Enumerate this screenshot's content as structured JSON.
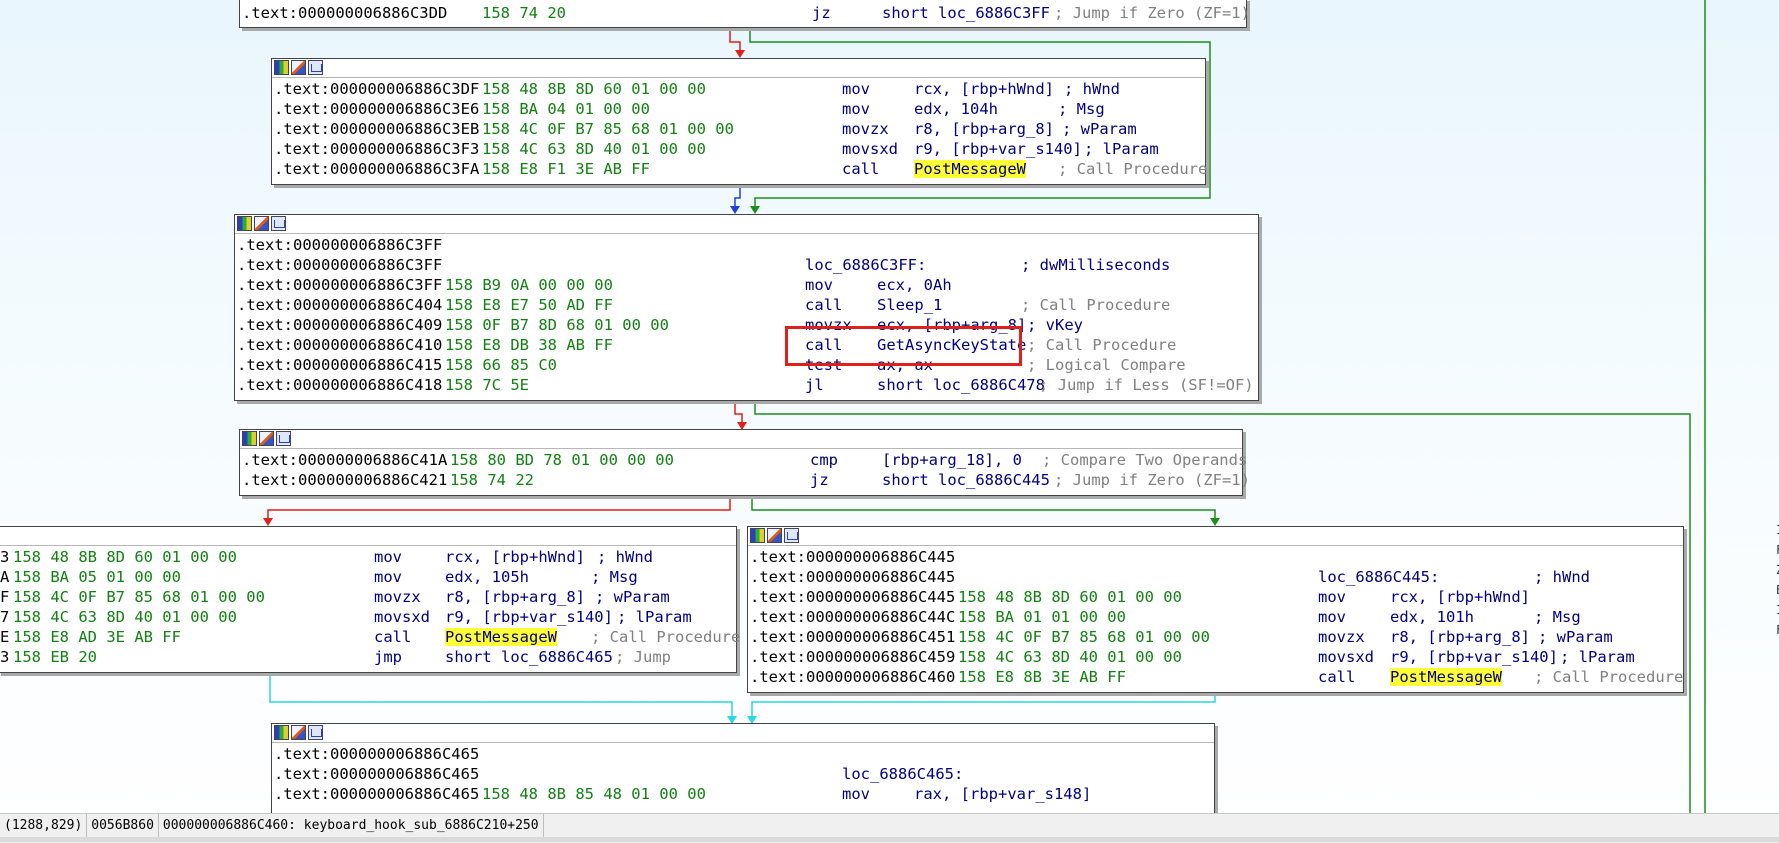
{
  "colors": {
    "edge_false": "#e0201a",
    "edge_true": "#1a8f1a",
    "edge_uncond": "#1f3fe0",
    "edge_merge": "#27d6e8",
    "highlight": "#ffff33",
    "address": "#000000",
    "bytes": "#138013",
    "mnemonic": "#000080",
    "comment": "#808080",
    "selection_box": "#e0201a"
  },
  "blocks": {
    "b1": {
      "lines": [
        {
          "addr": ".text:000000006886C3DD",
          "bytes": "158 74 20",
          "mn": "jz",
          "op": "short loc_6886C3FF",
          "cm": "; Jump if Zero (ZF=1)"
        }
      ]
    },
    "b2": {
      "lines": [
        {
          "addr": ".text:000000006886C3DF",
          "bytes": "158 48 8B 8D 60 01 00 00",
          "mn": "mov",
          "op": "rcx, [rbp+hWnd]",
          "cm": "; hWnd"
        },
        {
          "addr": ".text:000000006886C3E6",
          "bytes": "158 BA 04 01 00 00",
          "mn": "mov",
          "op": "edx, 104h",
          "cm": "; Msg"
        },
        {
          "addr": ".text:000000006886C3EB",
          "bytes": "158 4C 0F B7 85 68 01 00 00",
          "mn": "movzx",
          "op": "r8, [rbp+arg_8]",
          "cm": "; wParam"
        },
        {
          "addr": ".text:000000006886C3F3",
          "bytes": "158 4C 63 8D 40 01 00 00",
          "mn": "movsxd",
          "op": "r9, [rbp+var_s140]",
          "cm": "; lParam"
        },
        {
          "addr": ".text:000000006886C3FA",
          "bytes": "158 E8 F1 3E AB FF",
          "mn": "call",
          "op": "PostMessageW",
          "cm": "; Call Procedure"
        }
      ]
    },
    "b3": {
      "label": "loc_6886C3FF:",
      "label_cm": "; dwMilliseconds",
      "lines": [
        {
          "addr": ".text:000000006886C3FF",
          "bytes": "",
          "mn": "",
          "op": "",
          "cm": ""
        },
        {
          "addr": ".text:000000006886C3FF",
          "bytes": "",
          "mn": "",
          "op": "",
          "cm": ""
        },
        {
          "addr": ".text:000000006886C3FF",
          "bytes": "158 B9 0A 00 00 00",
          "mn": "mov",
          "op": "ecx, 0Ah",
          "cm": ""
        },
        {
          "addr": ".text:000000006886C404",
          "bytes": "158 E8 E7 50 AD FF",
          "mn": "call",
          "op": "Sleep_1",
          "cm": "; Call Procedure"
        },
        {
          "addr": ".text:000000006886C409",
          "bytes": "158 0F B7 8D 68 01 00 00",
          "mn": "movzx",
          "op": "ecx, [rbp+arg_8]",
          "cm": "; vKey"
        },
        {
          "addr": ".text:000000006886C410",
          "bytes": "158 E8 DB 38 AB FF",
          "mn": "call",
          "op": "GetAsyncKeyState",
          "cm": "; Call Procedure"
        },
        {
          "addr": ".text:000000006886C415",
          "bytes": "158 66 85 C0",
          "mn": "test",
          "op": "ax, ax",
          "cm": "; Logical Compare"
        },
        {
          "addr": ".text:000000006886C418",
          "bytes": "158 7C 5E",
          "mn": "jl",
          "op": "short loc_6886C478",
          "cm": "; Jump if Less (SF!=OF)"
        }
      ]
    },
    "b4": {
      "lines": [
        {
          "addr": ".text:000000006886C41A",
          "bytes": "158 80 BD 78 01 00 00 00",
          "mn": "cmp",
          "op": "[rbp+arg_18], 0",
          "cm": "; Compare Two Operands"
        },
        {
          "addr": ".text:000000006886C421",
          "bytes": "158 74 22",
          "mn": "jz",
          "op": "short loc_6886C445",
          "cm": "; Jump if Zero (ZF=1)"
        }
      ]
    },
    "b5": {
      "lines": [
        {
          "addr": "3",
          "bytes": "158 48 8B 8D 60 01 00 00",
          "mn": "mov",
          "op": "rcx, [rbp+hWnd]",
          "cm": "; hWnd"
        },
        {
          "addr": "A",
          "bytes": "158 BA 05 01 00 00",
          "mn": "mov",
          "op": "edx, 105h",
          "cm": "; Msg"
        },
        {
          "addr": "F",
          "bytes": "158 4C 0F B7 85 68 01 00 00",
          "mn": "movzx",
          "op": "r8, [rbp+arg_8]",
          "cm": "; wParam"
        },
        {
          "addr": "7",
          "bytes": "158 4C 63 8D 40 01 00 00",
          "mn": "movsxd",
          "op": "r9, [rbp+var_s140]",
          "cm": "; lParam"
        },
        {
          "addr": "E",
          "bytes": "158 E8 AD 3E AB FF",
          "mn": "call",
          "op": "PostMessageW",
          "cm": "; Call Procedure"
        },
        {
          "addr": "3",
          "bytes": "158 EB 20",
          "mn": "jmp",
          "op": "short loc_6886C465",
          "cm": "; Jump"
        }
      ]
    },
    "b6": {
      "label": "loc_6886C445:",
      "label_cm": "; hWnd",
      "lines": [
        {
          "addr": ".text:000000006886C445",
          "bytes": "",
          "mn": "",
          "op": "",
          "cm": ""
        },
        {
          "addr": ".text:000000006886C445",
          "bytes": "",
          "mn": "",
          "op": "",
          "cm": ""
        },
        {
          "addr": ".text:000000006886C445",
          "bytes": "158 48 8B 8D 60 01 00 00",
          "mn": "mov",
          "op": "rcx, [rbp+hWnd]",
          "cm": ""
        },
        {
          "addr": ".text:000000006886C44C",
          "bytes": "158 BA 01 01 00 00",
          "mn": "mov",
          "op": "edx, 101h",
          "cm": "; Msg"
        },
        {
          "addr": ".text:000000006886C451",
          "bytes": "158 4C 0F B7 85 68 01 00 00",
          "mn": "movzx",
          "op": "r8, [rbp+arg_8]",
          "cm": "; wParam"
        },
        {
          "addr": ".text:000000006886C459",
          "bytes": "158 4C 63 8D 40 01 00 00",
          "mn": "movsxd",
          "op": "r9, [rbp+var_s140]",
          "cm": "; lParam"
        },
        {
          "addr": ".text:000000006886C460",
          "bytes": "158 E8 8B 3E AB FF",
          "mn": "call",
          "op": "PostMessageW",
          "cm": "; Call Procedure"
        }
      ]
    },
    "b7": {
      "label": "loc_6886C465:",
      "lines": [
        {
          "addr": ".text:000000006886C465",
          "bytes": "",
          "mn": "",
          "op": "",
          "cm": ""
        },
        {
          "addr": ".text:000000006886C465",
          "bytes": "",
          "mn": "",
          "op": "",
          "cm": ""
        },
        {
          "addr": ".text:000000006886C465",
          "bytes": "158 48 8B 85 48 01 00 00",
          "mn": "mov",
          "op": "rax, [rbp+var_s148]",
          "cm": ""
        }
      ]
    }
  },
  "statusbar": {
    "coords": "(1288,829)",
    "offset": "0056B860",
    "location": "000000006886C460: keyboard_hook_sub_6886C210+250"
  },
  "right_edge_glyphs": [
    "I",
    "F",
    "Z",
    "E",
    "I",
    "F"
  ]
}
